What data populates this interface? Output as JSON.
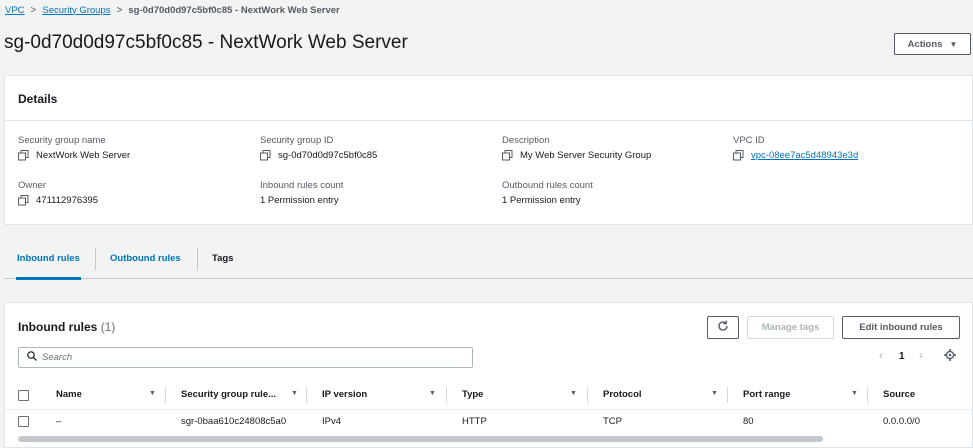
{
  "breadcrumb": {
    "items": [
      "VPC",
      "Security Groups"
    ],
    "current": "sg-0d70d0d97c5bf0c85 - NextWork Web Server",
    "separator": ">"
  },
  "page": {
    "title": "sg-0d70d0d97c5bf0c85 - NextWork Web Server",
    "actions_label": "Actions"
  },
  "details": {
    "title": "Details",
    "fields": {
      "sg_name": {
        "label": "Security group name",
        "value": "NextWork Web Server"
      },
      "sg_id": {
        "label": "Security group ID",
        "value": "sg-0d70d0d97c5bf0c85"
      },
      "description": {
        "label": "Description",
        "value": "My Web Server Security Group"
      },
      "vpc_id": {
        "label": "VPC ID",
        "value": "vpc-08ee7ac5d48943e3d"
      },
      "owner": {
        "label": "Owner",
        "value": "471112976395"
      },
      "inbound_count": {
        "label": "Inbound rules count",
        "value": "1 Permission entry"
      },
      "outbound_count": {
        "label": "Outbound rules count",
        "value": "1 Permission entry"
      }
    }
  },
  "tabs": [
    "Inbound rules",
    "Outbound rules",
    "Tags"
  ],
  "inbound": {
    "title": "Inbound rules",
    "count": "(1)",
    "manage_tags_label": "Manage tags",
    "edit_label": "Edit inbound rules",
    "search_placeholder": "Search",
    "page_number": "1",
    "columns": [
      "Name",
      "Security group rule...",
      "IP version",
      "Type",
      "Protocol",
      "Port range",
      "Source"
    ],
    "rows": [
      {
        "name": "–",
        "rule_id": "sgr-0baa610c24808c5a0",
        "ip_version": "IPv4",
        "type": "HTTP",
        "protocol": "TCP",
        "port_range": "80",
        "source": "0.0.0.0/0"
      }
    ]
  },
  "colors": {
    "link": "#0073bb",
    "background": "#f2f3f3",
    "panel": "#ffffff"
  },
  "icons": [
    "copy-icon",
    "refresh-icon",
    "search-icon",
    "settings-gear-icon",
    "caret-down-icon",
    "sort-caret-icon",
    "chevron-left-icon",
    "chevron-right-icon"
  ]
}
